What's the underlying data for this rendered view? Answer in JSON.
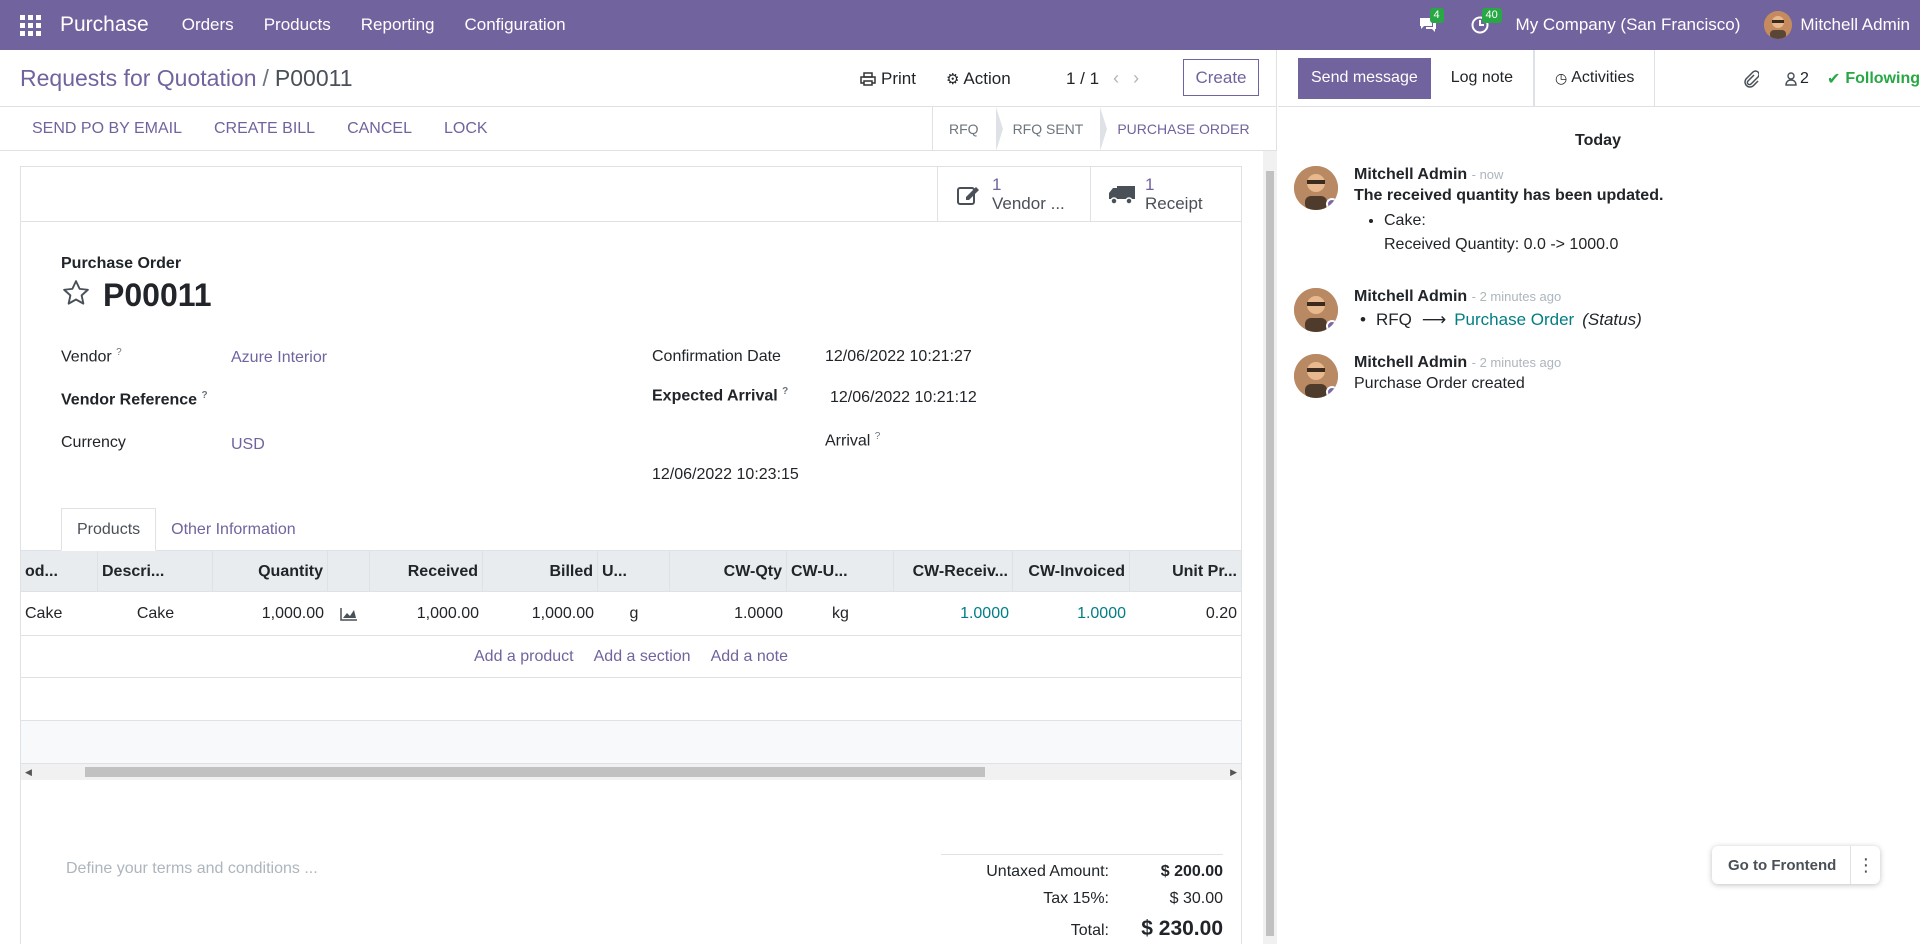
{
  "topbar": {
    "app_name": "Purchase",
    "menu": [
      "Orders",
      "Products",
      "Reporting",
      "Configuration"
    ],
    "messages_count": "4",
    "activities_count": "40",
    "company": "My Company (San Francisco)",
    "user": "Mitchell Admin",
    "accent": "#71639e"
  },
  "control_panel": {
    "breadcrumb_parent": "Requests for Quotation",
    "breadcrumb_sep": "/",
    "breadcrumb_current": "P00011",
    "print_label": "Print",
    "action_label": "Action",
    "pager": "1 / 1",
    "create_label": "Create"
  },
  "header_buttons": [
    "SEND PO BY EMAIL",
    "CREATE BILL",
    "CANCEL",
    "LOCK"
  ],
  "statusbar": [
    "RFQ",
    "RFQ SENT",
    "PURCHASE ORDER"
  ],
  "smart_buttons": {
    "vendor_bills": {
      "count": "1",
      "label": "Vendor ..."
    },
    "receipt": {
      "count": "1",
      "label": "Receipt"
    }
  },
  "form": {
    "title_label": "Purchase Order",
    "name": "P00011",
    "vendor_label": "Vendor",
    "vendor": "Azure Interior",
    "vendor_ref_label": "Vendor Reference",
    "currency_label": "Currency",
    "currency": "USD",
    "confirmation_date_label": "Confirmation Date",
    "confirmation_date": "12/06/2022 10:21:27",
    "expected_arrival_label": "Expected Arrival",
    "expected_arrival": "12/06/2022 10:21:12",
    "arrival_label": "Arrival",
    "arrival": "12/06/2022 10:23:15",
    "help_mark": "?"
  },
  "tabs": [
    "Products",
    "Other Information"
  ],
  "order_lines": {
    "headers": [
      "od...",
      "Descri...",
      "Quantity",
      "Received",
      "Billed",
      "U...",
      "CW-Qty",
      "CW-U...",
      "CW-Receiv...",
      "CW-Invoiced",
      "Unit Pr..."
    ],
    "rows": [
      {
        "product": "Cake",
        "description": "Cake",
        "quantity": "1,000.00",
        "received": "1,000.00",
        "billed": "1,000.00",
        "uom": "g",
        "cw_qty": "1.0000",
        "cw_uom": "kg",
        "cw_received": "1.0000",
        "cw_invoiced": "1.0000",
        "unit_price": "0.20"
      }
    ],
    "add_product": "Add a product",
    "add_section": "Add a section",
    "add_note": "Add a note"
  },
  "footer": {
    "terms_placeholder": "Define your terms and conditions ...",
    "untaxed_label": "Untaxed Amount:",
    "untaxed": "$ 200.00",
    "tax_label": "Tax 15%:",
    "tax": "$ 30.00",
    "total_label": "Total:",
    "total": "$ 230.00"
  },
  "chatter": {
    "send_message": "Send message",
    "log_note": "Log note",
    "activities": "Activities",
    "followers_count": "2",
    "following": "Following",
    "date_separator": "Today",
    "messages": [
      {
        "author": "Mitchell Admin",
        "time": "- now",
        "text": "The received quantity has been updated.",
        "item": "Cake:",
        "detail": "Received Quantity: 0.0 -> 1000.0"
      },
      {
        "author": "Mitchell Admin",
        "time": "- 2 minutes ago",
        "from": "RFQ",
        "to": "Purchase Order",
        "field": "(Status)"
      },
      {
        "author": "Mitchell Admin",
        "time": "- 2 minutes ago",
        "text": "Purchase Order created"
      }
    ]
  },
  "go_frontend": "Go to Frontend"
}
